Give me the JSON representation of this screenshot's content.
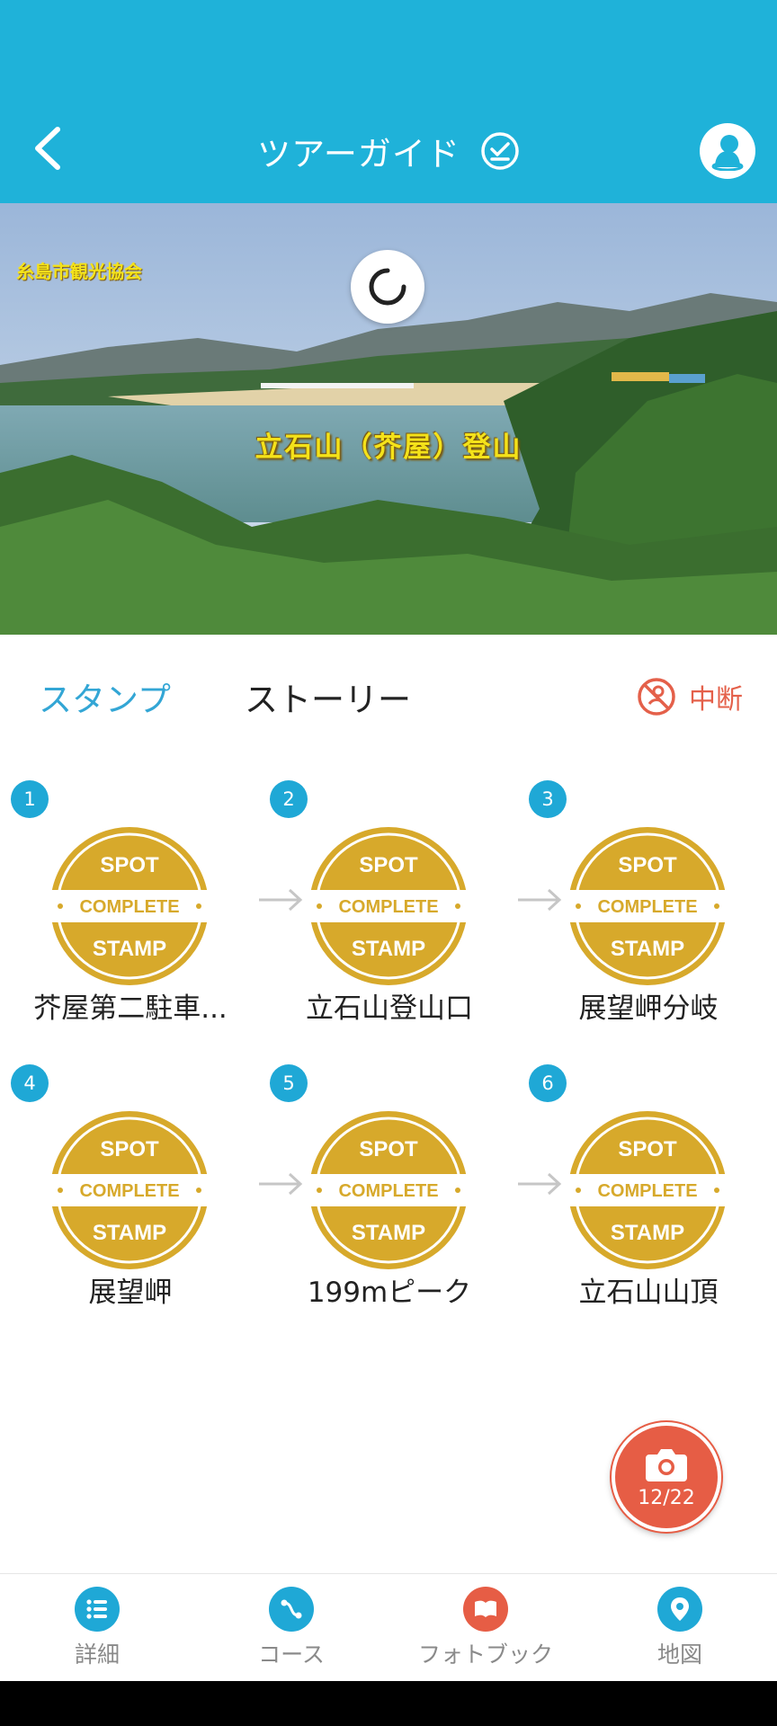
{
  "header": {
    "title": "ツアーガイド"
  },
  "hero": {
    "caption": "立石山（芥屋）登山",
    "tag": "糸島市観光協会"
  },
  "tabs": {
    "stamp": "スタンプ",
    "story": "ストーリー",
    "interrupt": "中断"
  },
  "seal": {
    "top": "SPOT",
    "middle": "COMPLETE",
    "bottom": "STAMP"
  },
  "spots": [
    {
      "number": "1",
      "name": "芥屋第二駐車..."
    },
    {
      "number": "2",
      "name": "立石山登山口"
    },
    {
      "number": "3",
      "name": "展望岬分岐"
    },
    {
      "number": "4",
      "name": "展望岬"
    },
    {
      "number": "5",
      "name": "199mピーク"
    },
    {
      "number": "6",
      "name": "立石山山頂"
    }
  ],
  "fab": {
    "count": "12/22"
  },
  "nav": {
    "details": "詳細",
    "course": "コース",
    "photobook": "フォトブック",
    "map": "地図"
  },
  "colors": {
    "primary": "#1fb2d9",
    "accent": "#e65d45",
    "seal_gold": "#d7a92b"
  }
}
